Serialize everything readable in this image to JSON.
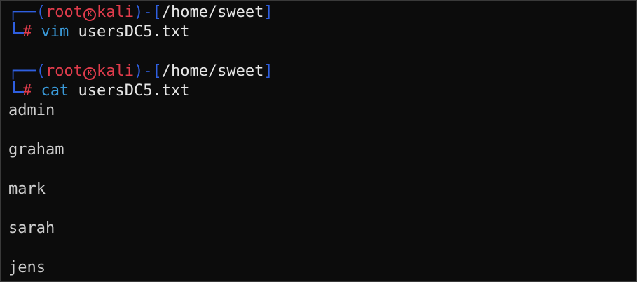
{
  "prompts": [
    {
      "box_open": "┌──(",
      "user": "root",
      "skull_glyph": "K",
      "host": "kali",
      "sep": ")-[",
      "path": "/home/sweet",
      "box_close": "]",
      "hash": "#",
      "command": "vim",
      "argument": "usersDC5.txt"
    },
    {
      "box_open": "┌──(",
      "user": "root",
      "skull_glyph": "K",
      "host": "kali",
      "sep": ")-[",
      "path": "/home/sweet",
      "box_close": "]",
      "hash": "#",
      "command": "cat",
      "argument": "usersDC5.txt"
    }
  ],
  "output_lines": [
    "admin",
    "",
    "graham",
    "",
    "mark",
    "",
    "sarah",
    "",
    "jens"
  ],
  "colors": {
    "background": "#0c0c0c",
    "prompt_box": "#2f5fe0",
    "prompt_user": "#e03c4c",
    "command": "#3a9ad9",
    "text": "#e6e6e6"
  }
}
